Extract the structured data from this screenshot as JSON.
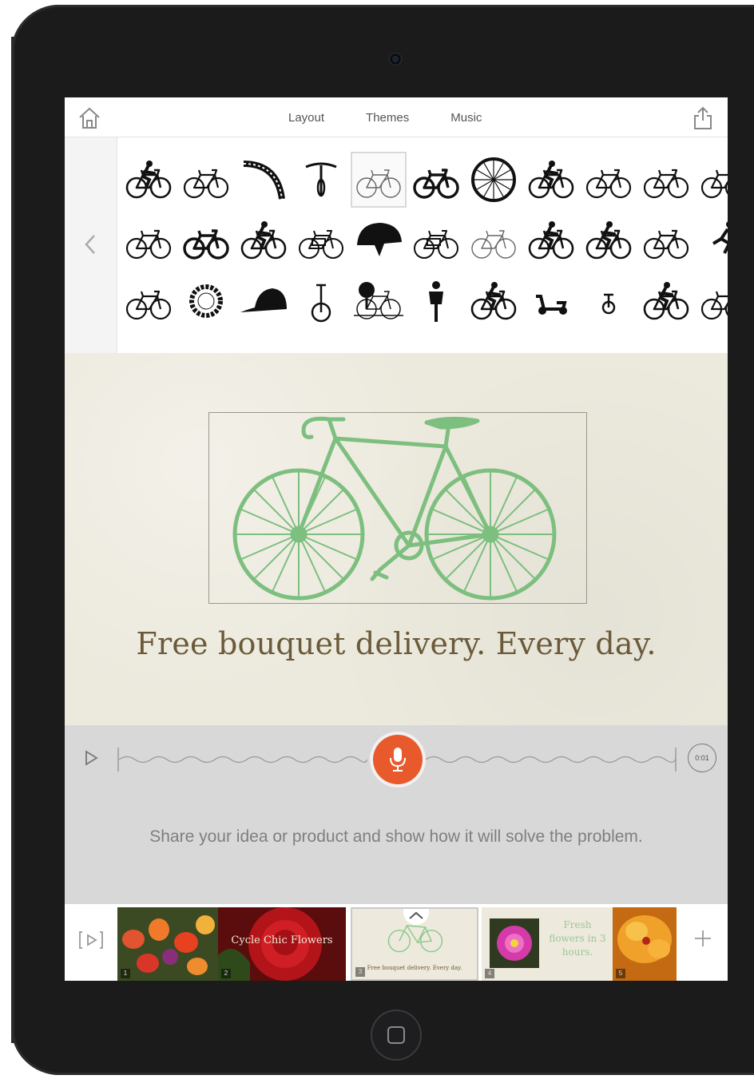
{
  "topbar": {
    "tabs": [
      "Layout",
      "Themes",
      "Music"
    ]
  },
  "icons": {
    "rows": [
      [
        "tandem-child-bike-icon",
        "bicycle-icon",
        "wheel-arc-icon",
        "handlebar-icon",
        "bicycle-outline-icon",
        "bicycle-bold-icon",
        "spoked-wheel-icon",
        "cyclist-icon",
        "bicycle-icon",
        "bicycle-thin-icon",
        "bicycle-partial-icon"
      ],
      [
        "bicycle-icon",
        "bicycle-bold-icon",
        "cyclist-icon",
        "cruiser-bike-icon",
        "helmet-icon",
        "cargo-bike-icon",
        "bicycle-light-icon",
        "cyclist-icon",
        "racing-cyclist-icon",
        "bicycle-icon",
        "runner-icon"
      ],
      [
        "bicycle-icon",
        "chainring-icon",
        "cap-icon",
        "unicycle-icon",
        "tree-cyclist-icon",
        "rider-front-icon",
        "bmx-rider-icon",
        "scooter-icon",
        "unicycle-small-icon",
        "cyclist-icon",
        "bicycle-partial-icon"
      ]
    ],
    "selected": "bicycle-outline-icon"
  },
  "slide": {
    "headline": "Free bouquet delivery. Every day.",
    "bike_color": "#7cbf7e",
    "text_color": "#6b5a3a"
  },
  "voice": {
    "timer": "0:01",
    "prompt": "Share your idea or product and show how it will solve the problem.",
    "mic_color": "#e85a2c"
  },
  "filmstrip": {
    "thumbs": [
      {
        "num": "1",
        "overlay": ""
      },
      {
        "num": "2",
        "overlay": "Cycle Chic Flowers"
      },
      {
        "num": "3",
        "overlay": "Free bouquet delivery. Every day."
      },
      {
        "num": "4",
        "overlay": "Fresh flowers in 3 hours."
      },
      {
        "num": "5",
        "overlay": ""
      }
    ]
  }
}
